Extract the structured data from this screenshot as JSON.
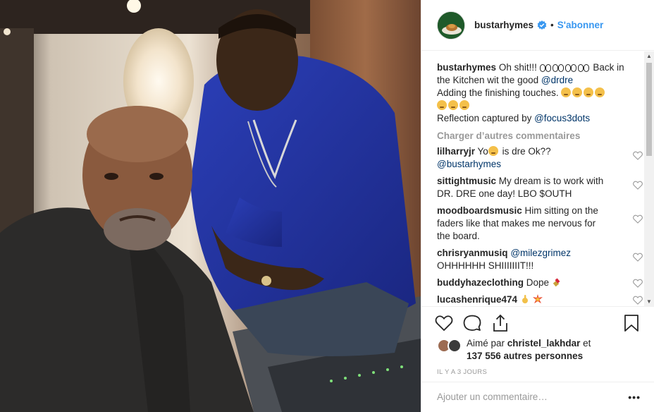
{
  "photo": {
    "alt": ""
  },
  "header": {
    "username": "bustarhymes",
    "separator": "•",
    "follow_label": "S'abonner",
    "verified_icon": "verified-badge-icon"
  },
  "caption": {
    "username": "bustarhymes",
    "text_1": "Oh shit!!!",
    "text_2": "Back in the Kitchen wit the good",
    "mention_1": "@drdre",
    "text_3": "Adding the finishing touches.",
    "text_4": "Reflection captured by",
    "mention_2": "@focus3dots"
  },
  "load_more_label": "Charger d’autres commentaires",
  "comments": [
    {
      "user": "lilharryjr",
      "text_before": "Yo",
      "text_after": " is dre Ok??",
      "mention": "@bustarhymes"
    },
    {
      "user": "sittightmusic",
      "text": "My dream is to work with DR. DRE one day! LBO $OUTH"
    },
    {
      "user": "moodboardsmusic",
      "text": "Him sitting on the faders like that makes me nervous for the board."
    },
    {
      "user": "chrisryanmusiq",
      "mention": "@milezgrimez",
      "text": "OHHHHHH SHIIIIIIIT!!!"
    },
    {
      "user": "buddyhazeclothing",
      "text": "Dope"
    },
    {
      "user": "lucashenrique474",
      "text": ""
    }
  ],
  "actions": {
    "like_icon": "heart-icon",
    "comment_icon": "comment-icon",
    "share_icon": "share-icon",
    "save_icon": "bookmark-icon"
  },
  "likes": {
    "prefix": "Aimé par",
    "user": "christel_lakhdar",
    "conjunction": "et",
    "count": "137 556 autres personnes"
  },
  "timestamp": "IL Y A 3 JOURS",
  "add_comment": {
    "placeholder": "Ajouter un commentaire…",
    "options": "•••"
  },
  "colors": {
    "link": "#3897f0",
    "mention": "#003569",
    "muted": "#999999",
    "text": "#262626"
  }
}
